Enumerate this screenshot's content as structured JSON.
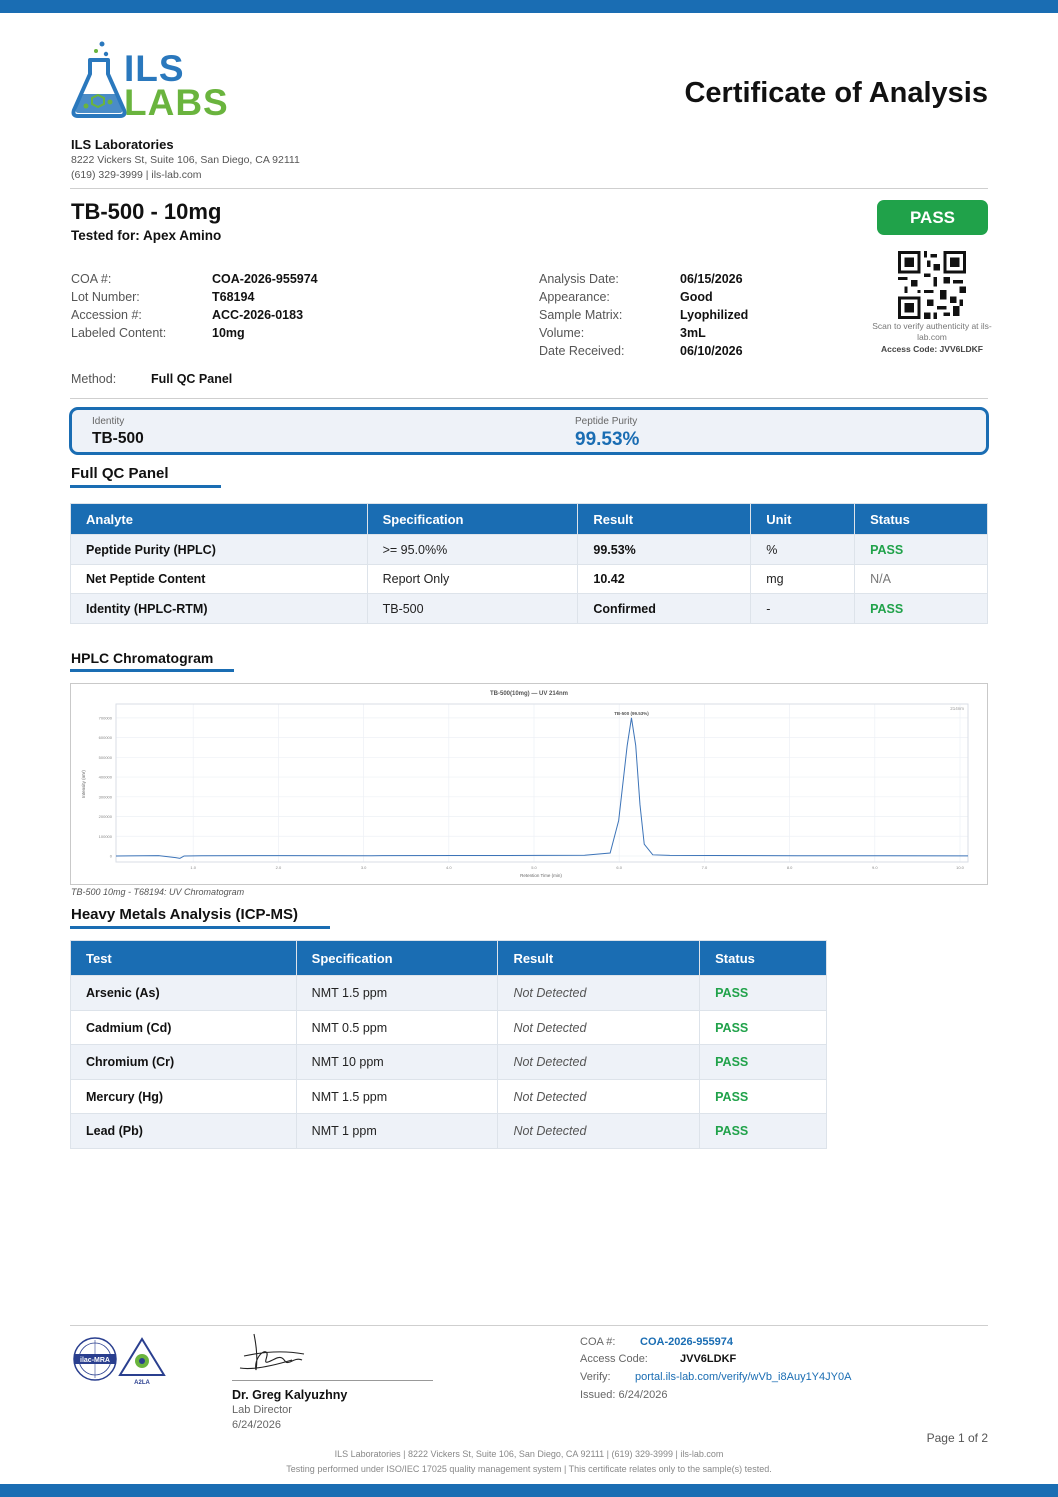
{
  "brand": {
    "logo_line1": "ILS",
    "logo_line2": "LABS",
    "primary_color": "#1a6db3",
    "accent_green": "#6ab43e",
    "pass_color": "#20a24a"
  },
  "header": {
    "doc_title": "Certificate of Analysis",
    "lab_name": "ILS Laboratories",
    "lab_address": "8222 Vickers St, Suite 106, San Diego, CA 92111",
    "lab_contact": "(619) 329-3999  |  ils-lab.com"
  },
  "product": {
    "title": "TB-500 - 10mg",
    "tested_for": "Tested for: Apex Amino",
    "overall_status": "PASS"
  },
  "meta_left": [
    {
      "label": "COA #:",
      "value": "COA-2026-955974"
    },
    {
      "label": "Lot Number:",
      "value": "T68194"
    },
    {
      "label": "Accession #:",
      "value": "ACC-2026-0183"
    },
    {
      "label": "Labeled Content:",
      "value": "10mg"
    }
  ],
  "meta_right": [
    {
      "label": "Analysis Date:",
      "value": "06/15/2026"
    },
    {
      "label": "Appearance:",
      "value": "Good"
    },
    {
      "label": "Sample Matrix:",
      "value": "Lyophilized"
    },
    {
      "label": "Volume:",
      "value": "3mL"
    },
    {
      "label": "Date Received:",
      "value": "06/10/2026"
    }
  ],
  "method": {
    "label": "Method:",
    "value": "Full QC Panel"
  },
  "qr": {
    "note": "Scan to verify authenticity at ils-lab.com",
    "access_code": "Access Code: JVV6LDKF"
  },
  "summary": {
    "identity_label": "Identity",
    "identity_value": "TB-500",
    "purity_label": "Peptide Purity",
    "purity_value": "99.53%"
  },
  "qc_panel": {
    "title": "Full QC Panel",
    "headers": [
      "Analyte",
      "Specification",
      "Result",
      "Unit",
      "Status"
    ],
    "rows": [
      [
        "Peptide Purity (HPLC)",
        ">= 95.0%%",
        "99.53%",
        "%",
        "PASS"
      ],
      [
        "Net Peptide Content",
        "Report Only",
        "10.42",
        "mg",
        "N/A"
      ],
      [
        "Identity (HPLC-RTM)",
        "TB-500",
        "Confirmed",
        "-",
        "PASS"
      ]
    ]
  },
  "chromatogram": {
    "section_title": "HPLC Chromatogram",
    "caption": "TB-500 10mg - T68194: UV Chromatogram"
  },
  "chart_data": {
    "type": "line",
    "title": "TB-500(10mg) — UV 214nm",
    "xlabel": "Retention Time (min)",
    "ylabel": "Intensity (mV)",
    "peak_label": "TB-500 (99.53%)",
    "legend": "214nm",
    "xlim": [
      0,
      10
    ],
    "ylim": [
      0,
      750000
    ],
    "y_ticks": [
      "0",
      "100000",
      "200000",
      "300000",
      "400000",
      "500000",
      "600000",
      "700000"
    ],
    "x_ticks": [
      "1.0",
      "2.0",
      "3.0",
      "4.0",
      "5.0",
      "6.0",
      "7.0",
      "8.0",
      "9.0",
      "10.0"
    ],
    "series": [
      {
        "x": [
          0.0,
          0.5,
          0.7,
          0.75,
          0.8,
          1.0,
          2.0,
          3.0,
          4.0,
          5.0,
          5.5,
          5.8,
          5.9,
          6.0,
          6.05,
          6.1,
          6.15,
          6.2,
          6.3,
          6.5,
          7.0,
          8.0,
          9.0,
          10.0
        ],
        "y": [
          0,
          2000,
          -8000,
          -12000,
          0,
          1000,
          2000,
          1500,
          2500,
          3000,
          4000,
          15000,
          180000,
          560000,
          700000,
          560000,
          260000,
          60000,
          6000,
          3000,
          2500,
          1500,
          1000,
          500
        ]
      }
    ]
  },
  "heavy_metals": {
    "title": "Heavy Metals Analysis (ICP-MS)",
    "headers": [
      "Test",
      "Specification",
      "Result",
      "Status"
    ],
    "rows": [
      [
        "Arsenic (As)",
        "NMT 1.5 ppm",
        "Not Detected",
        "PASS"
      ],
      [
        "Cadmium (Cd)",
        "NMT 0.5 ppm",
        "Not Detected",
        "PASS"
      ],
      [
        "Chromium (Cr)",
        "NMT 10 ppm",
        "Not Detected",
        "PASS"
      ],
      [
        "Mercury (Hg)",
        "NMT 1.5 ppm",
        "Not Detected",
        "PASS"
      ],
      [
        "Lead (Pb)",
        "NMT 1 ppm",
        "Not Detected",
        "PASS"
      ]
    ]
  },
  "accreditation": {
    "badge1": "ilac-MRA",
    "badge2": "A2LA"
  },
  "signature": {
    "name": "Dr. Greg Kalyuzhny",
    "role": "Lab Director",
    "date": "6/24/2026"
  },
  "verification": {
    "coa_label": "COA #:",
    "coa_value": "COA-2026-955974",
    "access_label": "Access Code:",
    "access_value": "JVV6LDKF",
    "verify_label": "Verify:",
    "verify_value": "portal.ils-lab.com/verify/wVb_i8Auy1Y4JY0A",
    "issued": "Issued: 6/24/2026"
  },
  "footer": {
    "page": "Page 1 of 2",
    "line1": "ILS Laboratories  |  8222 Vickers St, Suite 106, San Diego, CA 92111  |  (619) 329-3999  |  ils-lab.com",
    "line2": "Testing performed under ISO/IEC 17025 quality management system  |  This certificate relates only to the sample(s) tested."
  }
}
